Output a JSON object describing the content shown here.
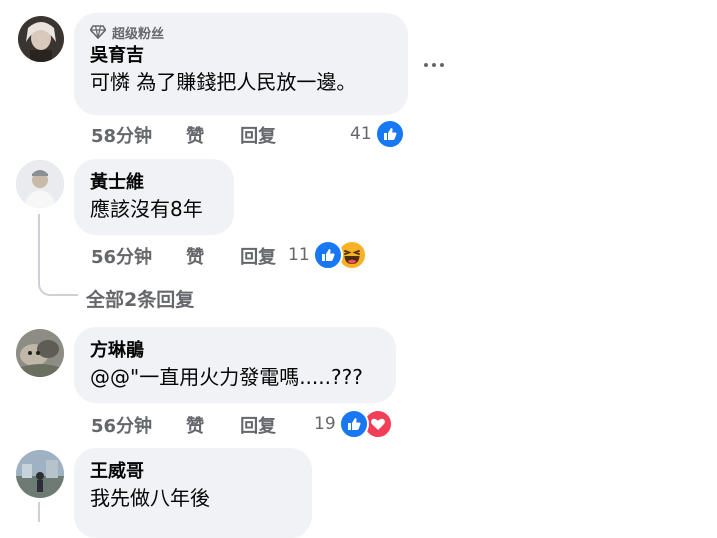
{
  "comments": [
    {
      "badge": "超级粉丝",
      "name": "吳育吉",
      "text": "可憐 為了賺錢把人民放一邊。",
      "time": "58分钟",
      "like": "赞",
      "reply": "回复",
      "reactions_count": "41",
      "reactions": [
        "like"
      ]
    },
    {
      "name": "黃士維",
      "text": "應該沒有8年",
      "time": "56分钟",
      "like": "赞",
      "reply": "回复",
      "reactions_count": "11",
      "reactions": [
        "like",
        "haha"
      ]
    },
    {
      "name": "方琳鵑",
      "text": "@@\"一直用火力發電嗎.....???",
      "time": "56分钟",
      "like": "赞",
      "reply": "回复",
      "reactions_count": "19",
      "reactions": [
        "like",
        "love"
      ]
    },
    {
      "name": "王威哥",
      "text": "我先做八年後"
    }
  ],
  "view_replies": "全部2条回复",
  "colors": {
    "like_blue": "#1877f2",
    "love_red": "#f33e58",
    "haha_yellow": "#f7b125",
    "bubble": "#f0f2f5",
    "meta_gray": "#65676b"
  },
  "icons": {
    "more": "more-horizontal-icon",
    "badge": "diamond-icon"
  }
}
